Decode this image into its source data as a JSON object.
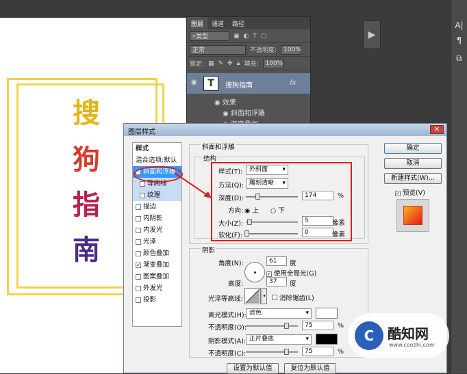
{
  "canvas": {
    "chars": [
      "搜",
      "狗",
      "指",
      "南"
    ]
  },
  "layers_panel": {
    "tabs": [
      "图层",
      "通道",
      "路径"
    ],
    "filter_label": "类型",
    "blend_mode": "正常",
    "opacity_label": "不透明度:",
    "opacity_value": "100%",
    "lock_label": "锁定:",
    "fill_label": "填充:",
    "fill_value": "100%",
    "layer_name": "搜狗指南",
    "fx_label": "fx",
    "effects_label": "效果",
    "effect_bevel": "斜面和浮雕",
    "effect_gradient": "渐变叠加"
  },
  "dialog": {
    "title": "图层样式",
    "close_label": "✕",
    "styles_header": "样式",
    "styles": [
      {
        "label": "混合选项:默认",
        "checkbox": false,
        "checked": false
      },
      {
        "label": "斜面和浮雕",
        "checkbox": true,
        "checked": true,
        "selected": true
      },
      {
        "label": "等高线",
        "checkbox": true,
        "checked": false,
        "sub": true
      },
      {
        "label": "纹理",
        "checkbox": true,
        "checked": false,
        "sub": true
      },
      {
        "label": "描边",
        "checkbox": true,
        "checked": false
      },
      {
        "label": "内阴影",
        "checkbox": true,
        "checked": false
      },
      {
        "label": "内发光",
        "checkbox": true,
        "checked": false
      },
      {
        "label": "光泽",
        "checkbox": true,
        "checked": false
      },
      {
        "label": "颜色叠加",
        "checkbox": true,
        "checked": false
      },
      {
        "label": "渐变叠加",
        "checkbox": true,
        "checked": true
      },
      {
        "label": "图案叠加",
        "checkbox": true,
        "checked": false
      },
      {
        "label": "外发光",
        "checkbox": true,
        "checked": false
      },
      {
        "label": "投影",
        "checkbox": true,
        "checked": false
      }
    ],
    "bevel": {
      "section": "斜面和浮雕",
      "structure": "结构",
      "style_label": "样式(T):",
      "style_value": "外斜面",
      "method_label": "方法(Q):",
      "method_value": "雕刻清晰",
      "depth_label": "深度(D):",
      "depth_value": "174",
      "depth_unit": "%",
      "direction_label": "方向:",
      "dir_up": "上",
      "dir_down": "下",
      "size_label": "大小(Z):",
      "size_value": "5",
      "size_unit": "像素",
      "soften_label": "软化(F):",
      "soften_value": "0",
      "soften_unit": "像素"
    },
    "shading": {
      "section": "阴影",
      "angle_label": "角度(N):",
      "angle_value": "61",
      "angle_unit": "度",
      "global_light": "使用全局光(G)",
      "altitude_label": "高度:",
      "altitude_value": "37",
      "altitude_unit": "度",
      "gloss_label": "光泽等高线:",
      "antialias": "消除锯齿(L)",
      "highlight_label": "高光模式(H):",
      "highlight_value": "滤色",
      "hl_opacity_label": "不透明度(O):",
      "hl_opacity_value": "75",
      "hl_opacity_unit": "%",
      "shadow_label": "阴影模式(A):",
      "shadow_value": "正片叠底",
      "sh_opacity_label": "不透明度(C):",
      "sh_opacity_value": "75",
      "sh_opacity_unit": "%"
    },
    "buttons": {
      "ok": "确定",
      "cancel": "取消",
      "new_style": "新建样式(W)...",
      "preview": "预览(V)",
      "set_default": "设置为默认值",
      "reset_default": "复位为默认值"
    }
  },
  "watermark": {
    "brand": "酷知网",
    "url": "www.coozhi.com"
  },
  "colors": {
    "highlight_red": "#e01b1b",
    "selection_blue": "#3399ff",
    "frame_gold": "#f1d34a"
  }
}
